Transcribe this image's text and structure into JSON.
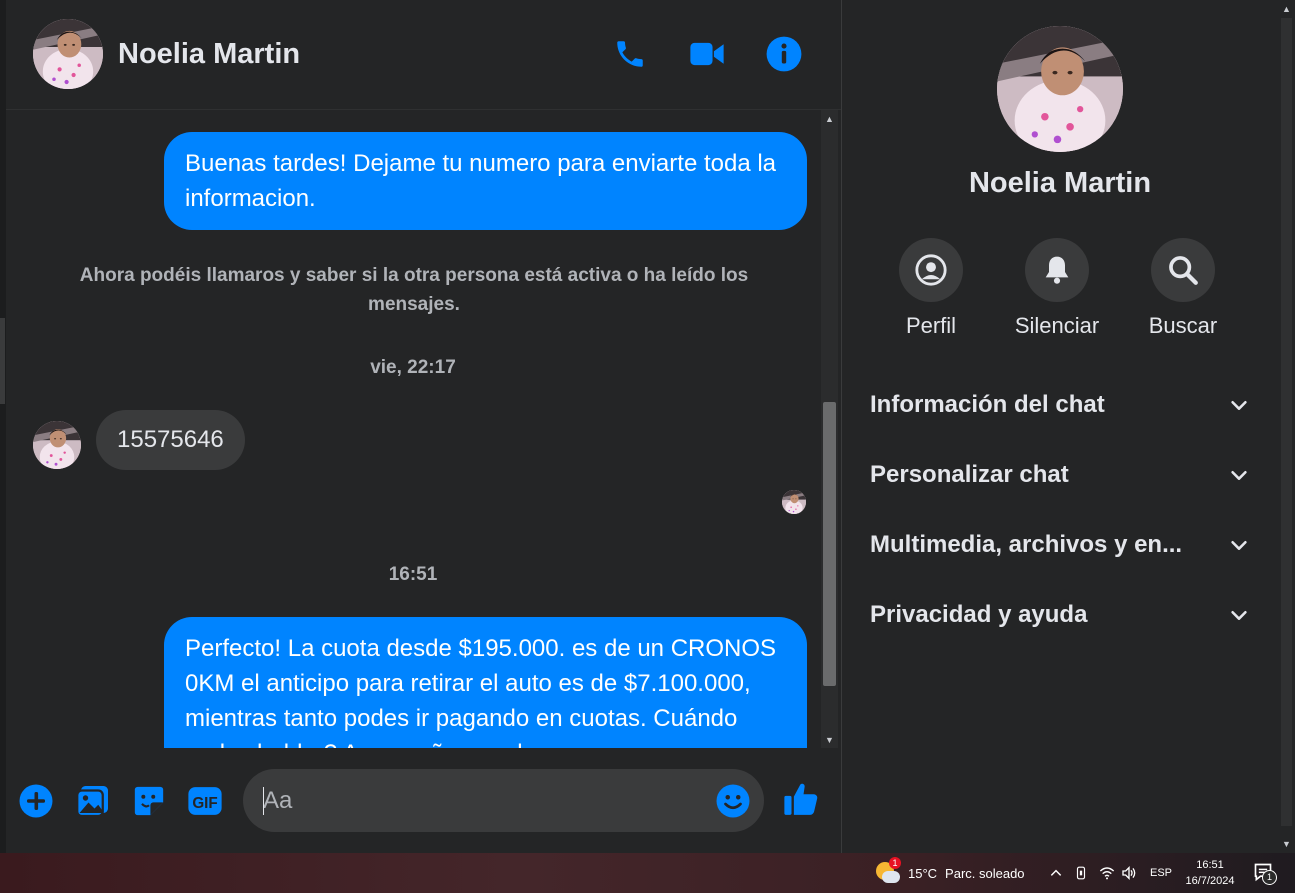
{
  "contact": {
    "name": "Noelia Martin"
  },
  "colors": {
    "accent": "#0084ff",
    "background": "#242526",
    "bubble_in": "#3a3b3c"
  },
  "header": {
    "icons": [
      "phone-icon",
      "video-camera-icon",
      "info-icon"
    ]
  },
  "messages": {
    "outgoing_1": "Buenas tardes! Dejame tu numero para enviarte toda la informacion.",
    "system_notice": "Ahora podéis llamaros y saber si la otra persona está activa o ha leído los mensajes.",
    "timestamp_1": "vie, 22:17",
    "incoming_1": "15575646",
    "timestamp_2": "16:51",
    "outgoing_2": "Perfecto! La cuota desde $195.000. es de un CRONOS 0KM el anticipo para retirar el auto es de $7.100.000, mientras tanto podes ir pagando en cuotas. Cuándo podes hablar? Acompañame a la"
  },
  "composer": {
    "placeholder": "Aa",
    "icons": [
      "plus-icon",
      "image-icon",
      "sticker-icon",
      "gif-icon",
      "emoji-icon",
      "thumbs-up-icon"
    ],
    "gif_label": "GIF"
  },
  "panel": {
    "name": "Noelia Martin",
    "actions": [
      {
        "label": "Perfil",
        "icon": "profile-icon"
      },
      {
        "label": "Silenciar",
        "icon": "bell-icon"
      },
      {
        "label": "Buscar",
        "icon": "search-icon"
      }
    ],
    "sections": [
      {
        "label": "Información del chat"
      },
      {
        "label": "Personalizar chat"
      },
      {
        "label": "Multimedia, archivos y en..."
      },
      {
        "label": "Privacidad y ayuda"
      }
    ]
  },
  "taskbar": {
    "weather_temp": "15°C",
    "weather_desc": "Parc. soleado",
    "weather_badge": "1",
    "language": "ESP",
    "time": "16:51",
    "date": "16/7/2024",
    "notification_count": "1"
  }
}
